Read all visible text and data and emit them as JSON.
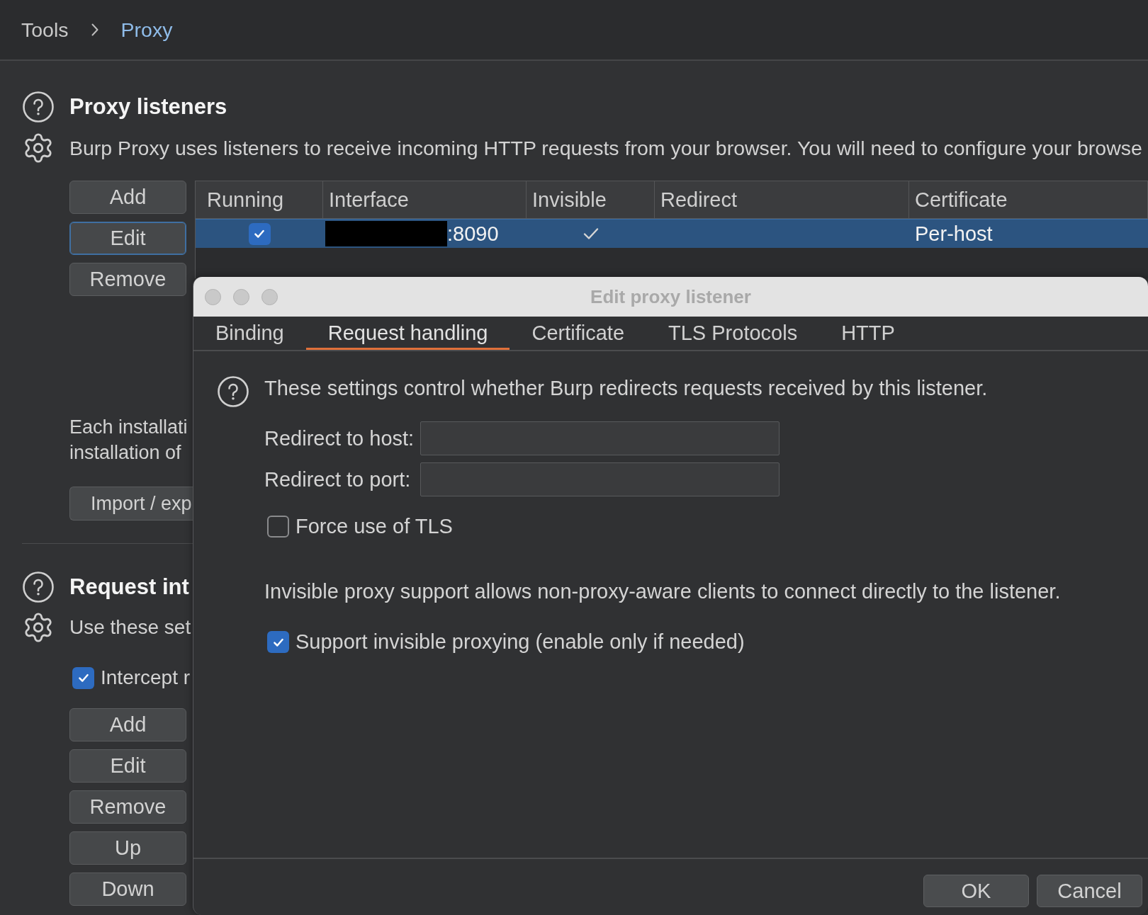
{
  "breadcrumb": [
    {
      "label": "Tools",
      "selected": false
    },
    {
      "label": "Proxy",
      "selected": true
    }
  ],
  "proxy_listeners": {
    "title": "Proxy listeners",
    "description": "Burp Proxy uses listeners to receive incoming HTTP requests from your browser. You will need to configure your browse",
    "buttons": [
      {
        "label": "Add",
        "focused": false
      },
      {
        "label": "Edit",
        "focused": true
      },
      {
        "label": "Remove",
        "focused": false
      }
    ],
    "table": {
      "columns": [
        "Running",
        "Interface",
        "Invisible",
        "Redirect",
        "Certificate"
      ],
      "rows": [
        {
          "selected": true,
          "running": true,
          "interface_redacted": true,
          "interface": ":8090",
          "invisible": true,
          "certificate": "Per-host"
        }
      ]
    }
  },
  "import_section": {
    "text_lines": [
      "Each installati",
      "installation of"
    ],
    "button": "Import / exp"
  },
  "request_interception": {
    "title": "Request int",
    "description": "Use these set",
    "intercept": {
      "label": "Intercept r",
      "checked": true
    },
    "buttons": [
      "Add",
      "Edit",
      "Remove",
      "Up",
      "Down"
    ]
  },
  "dialog": {
    "title": "Edit proxy listener",
    "tabs": [
      {
        "label": "Binding",
        "selected": false
      },
      {
        "label": "Request handling",
        "selected": true
      },
      {
        "label": "Certificate",
        "selected": false
      },
      {
        "label": "TLS Protocols",
        "selected": false
      },
      {
        "label": "HTTP",
        "selected": false
      }
    ],
    "intro": "These settings control whether Burp redirects requests received by this listener.",
    "fields": [
      {
        "label": "Redirect to host:"
      },
      {
        "label": "Redirect to port:"
      }
    ],
    "force_tls": {
      "label": "Force use of TLS",
      "checked": false
    },
    "invisible_note": "Invisible proxy support allows non-proxy-aware clients to connect directly to the listener.",
    "support_invisible": {
      "label": "Support invisible proxying (enable only if needed)",
      "checked": true
    },
    "buttons": [
      "OK",
      "Cancel"
    ]
  }
}
